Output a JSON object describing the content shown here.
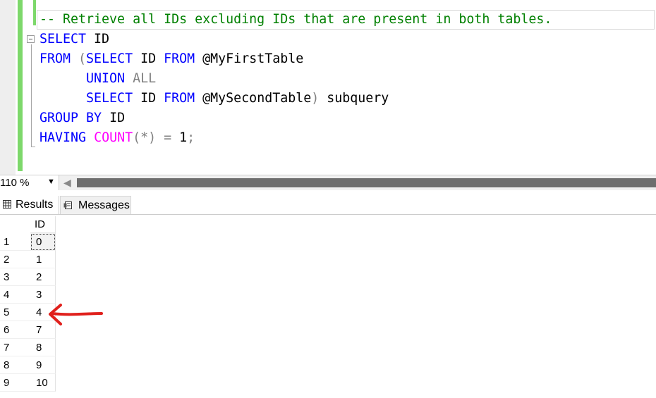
{
  "editor": {
    "lines": [
      [
        {
          "t": "-- Retrieve all IDs excluding IDs that are present in both tables.",
          "c": "cm"
        }
      ],
      [
        {
          "t": "SELECT",
          "c": "kw"
        },
        {
          "t": " ID",
          "c": "id"
        }
      ],
      [
        {
          "t": "FROM",
          "c": "kw"
        },
        {
          "t": " (",
          "c": "gr"
        },
        {
          "t": "SELECT",
          "c": "kw"
        },
        {
          "t": " ID ",
          "c": "id"
        },
        {
          "t": "FROM",
          "c": "kw"
        },
        {
          "t": " @MyFirstTable",
          "c": "id"
        }
      ],
      [
        {
          "t": "      UNION",
          "c": "kw"
        },
        {
          "t": " ALL",
          "c": "gr"
        }
      ],
      [
        {
          "t": "      SELECT",
          "c": "kw"
        },
        {
          "t": " ID ",
          "c": "id"
        },
        {
          "t": "FROM",
          "c": "kw"
        },
        {
          "t": " @MySecondTable",
          "c": "id"
        },
        {
          "t": ")",
          "c": "gr"
        },
        {
          "t": " subquery",
          "c": "id"
        }
      ],
      [
        {
          "t": "GROUP BY",
          "c": "kw"
        },
        {
          "t": " ID",
          "c": "id"
        }
      ],
      [
        {
          "t": "HAVING",
          "c": "kw"
        },
        {
          "t": " ",
          "c": "id"
        },
        {
          "t": "COUNT",
          "c": "fn"
        },
        {
          "t": "(*)",
          "c": "gr"
        },
        {
          "t": " ",
          "c": "id"
        },
        {
          "t": "=",
          "c": "gr"
        },
        {
          "t": " 1",
          "c": "id"
        },
        {
          "t": ";",
          "c": "gr"
        }
      ]
    ]
  },
  "zoom": {
    "level": "110 %"
  },
  "tabs": {
    "results": "Results",
    "messages": "Messages"
  },
  "grid": {
    "column_header": "ID",
    "row_numbers": [
      "1",
      "2",
      "3",
      "4",
      "5",
      "6",
      "7",
      "8",
      "9"
    ],
    "values": [
      "0",
      "1",
      "2",
      "3",
      "4",
      "7",
      "8",
      "9",
      "10"
    ]
  },
  "colors": {
    "keyword": "#0000ff",
    "comment": "#008000",
    "function": "#ff00ff",
    "operator": "#808080",
    "annotation": "#e0201c"
  },
  "icons": {
    "results_tab": "grid-icon",
    "messages_tab": "messages-icon",
    "annotation": "red-arrow-annotation"
  }
}
